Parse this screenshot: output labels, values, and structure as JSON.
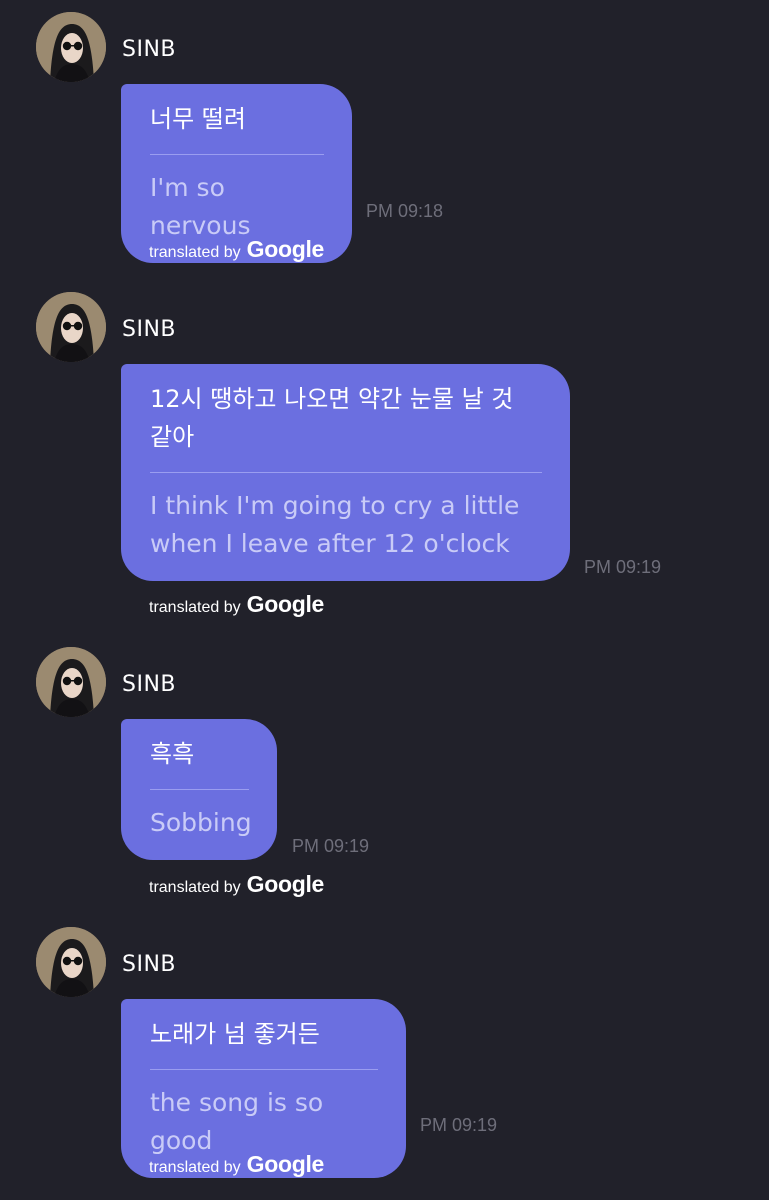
{
  "messages": [
    {
      "sender": "SINB",
      "original": "너무 떨려",
      "translation": "I'm so nervous",
      "time": "PM 09:18",
      "credit_prefix": "translated by",
      "credit_brand": "Google"
    },
    {
      "sender": "SINB",
      "original": "12시 땡하고 나오면 약간 눈물 날 것 같아",
      "translation": "I think I'm going to cry a little when I leave after 12 o'clock",
      "time": "PM 09:19",
      "credit_prefix": "translated by",
      "credit_brand": "Google"
    },
    {
      "sender": "SINB",
      "original": "흑흑",
      "translation": "Sobbing",
      "time": "PM 09:19",
      "credit_prefix": "translated by",
      "credit_brand": "Google"
    },
    {
      "sender": "SINB",
      "original": "노래가 넘 좋거든",
      "translation": "the song is so good",
      "time": "PM 09:19",
      "credit_prefix": "translated by",
      "credit_brand": "Google"
    }
  ]
}
